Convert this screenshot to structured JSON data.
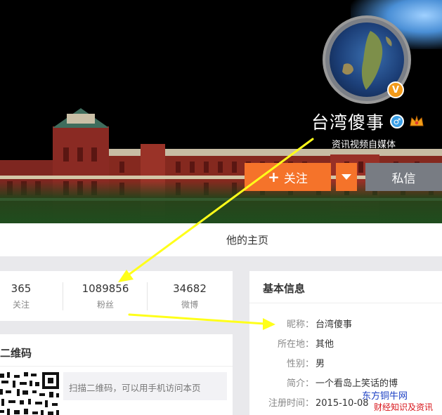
{
  "profile": {
    "name": "台湾傻事",
    "description": "资讯视频自媒体",
    "verified_badge": "V"
  },
  "actions": {
    "follow_plus": "+",
    "follow_label": "关注",
    "message_label": "私信"
  },
  "tabs": {
    "home_label": "他的主页"
  },
  "stats": [
    {
      "value": "365",
      "label": "关注"
    },
    {
      "value": "1089856",
      "label": "粉丝"
    },
    {
      "value": "34682",
      "label": "微博"
    }
  ],
  "qr": {
    "title": "二维码",
    "description": "扫描二维码，可以用手机访问本页"
  },
  "basic_info": {
    "title": "基本信息",
    "rows": [
      {
        "key": "昵称",
        "value": "台湾傻事"
      },
      {
        "key": "所在地",
        "value": "其他"
      },
      {
        "key": "性别",
        "value": "男"
      },
      {
        "key": "简介",
        "value": "一个看岛上笑话的博"
      },
      {
        "key": "注册时间",
        "value": "2015-10-08"
      }
    ],
    "separator": "："
  },
  "watermark": {
    "line1": "东方铜牛网",
    "line2": "财经知识及资讯"
  },
  "colors": {
    "follow": "#f5732a",
    "message": "#787c83",
    "annotation_arrow": "#ffff1a"
  },
  "icons": [
    "gender-male-icon",
    "crown-icon",
    "chevron-down-icon",
    "verified-icon"
  ]
}
